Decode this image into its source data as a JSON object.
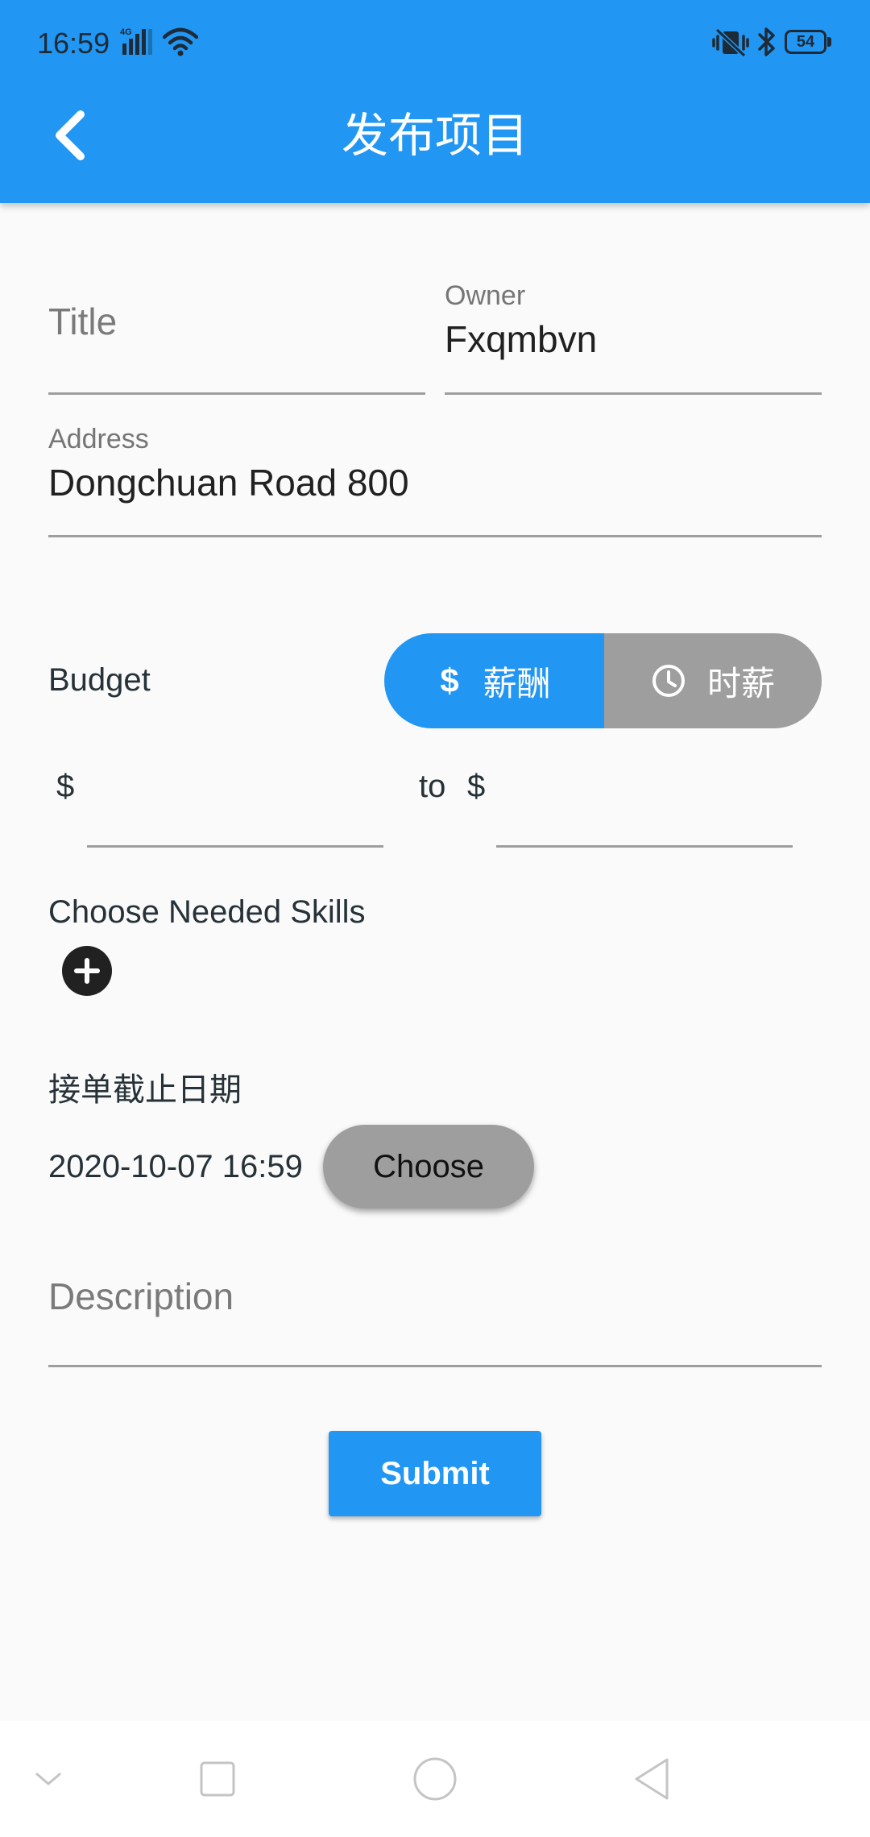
{
  "status_bar": {
    "time": "16:59",
    "network_type": "4G",
    "battery_level": "54",
    "icons": [
      "signal-icon",
      "wifi-icon",
      "vibrate-mute-icon",
      "bluetooth-icon",
      "battery-icon"
    ]
  },
  "app_bar": {
    "title": "发布项目",
    "back_icon": "back-arrow-icon"
  },
  "form": {
    "title_field": {
      "placeholder": "Title",
      "value": ""
    },
    "owner_field": {
      "label": "Owner",
      "value": "Fxqmbvn"
    },
    "address_field": {
      "label": "Address",
      "value": "Dongchuan Road 800"
    },
    "budget": {
      "label": "Budget",
      "toggle": {
        "selected": "salary",
        "options": [
          {
            "key": "salary",
            "label": "薪酬",
            "icon": "dollar-icon"
          },
          {
            "key": "hourly",
            "label": "时薪",
            "icon": "clock-icon"
          }
        ]
      },
      "min_prefix": "$",
      "min_value": "",
      "to_label": "to",
      "max_prefix": "$",
      "max_value": ""
    },
    "skills": {
      "label": "Choose Needed Skills",
      "add_icon": "add-circle-icon"
    },
    "deadline": {
      "label": "接单截止日期",
      "value": "2020-10-07 16:59",
      "choose_label": "Choose"
    },
    "description_field": {
      "placeholder": "Description",
      "value": ""
    },
    "submit_label": "Submit"
  },
  "nav_bar": {
    "items": [
      "collapse-icon",
      "recents-icon",
      "home-icon",
      "back-icon"
    ]
  },
  "colors": {
    "primary": "#2196f3",
    "toggle_inactive": "#9e9e9e",
    "background": "#fafafa"
  }
}
